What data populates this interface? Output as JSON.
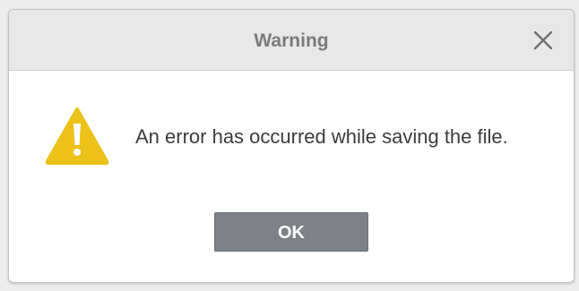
{
  "dialog": {
    "title": "Warning",
    "close_icon": "close-icon",
    "icon": "warning-triangle-icon",
    "message": "An error has occurred while saving the file.",
    "ok_label": "OK"
  },
  "colors": {
    "warning": "#ecc21a",
    "button": "#7e8287",
    "titlebar": "#e8e8e8"
  }
}
